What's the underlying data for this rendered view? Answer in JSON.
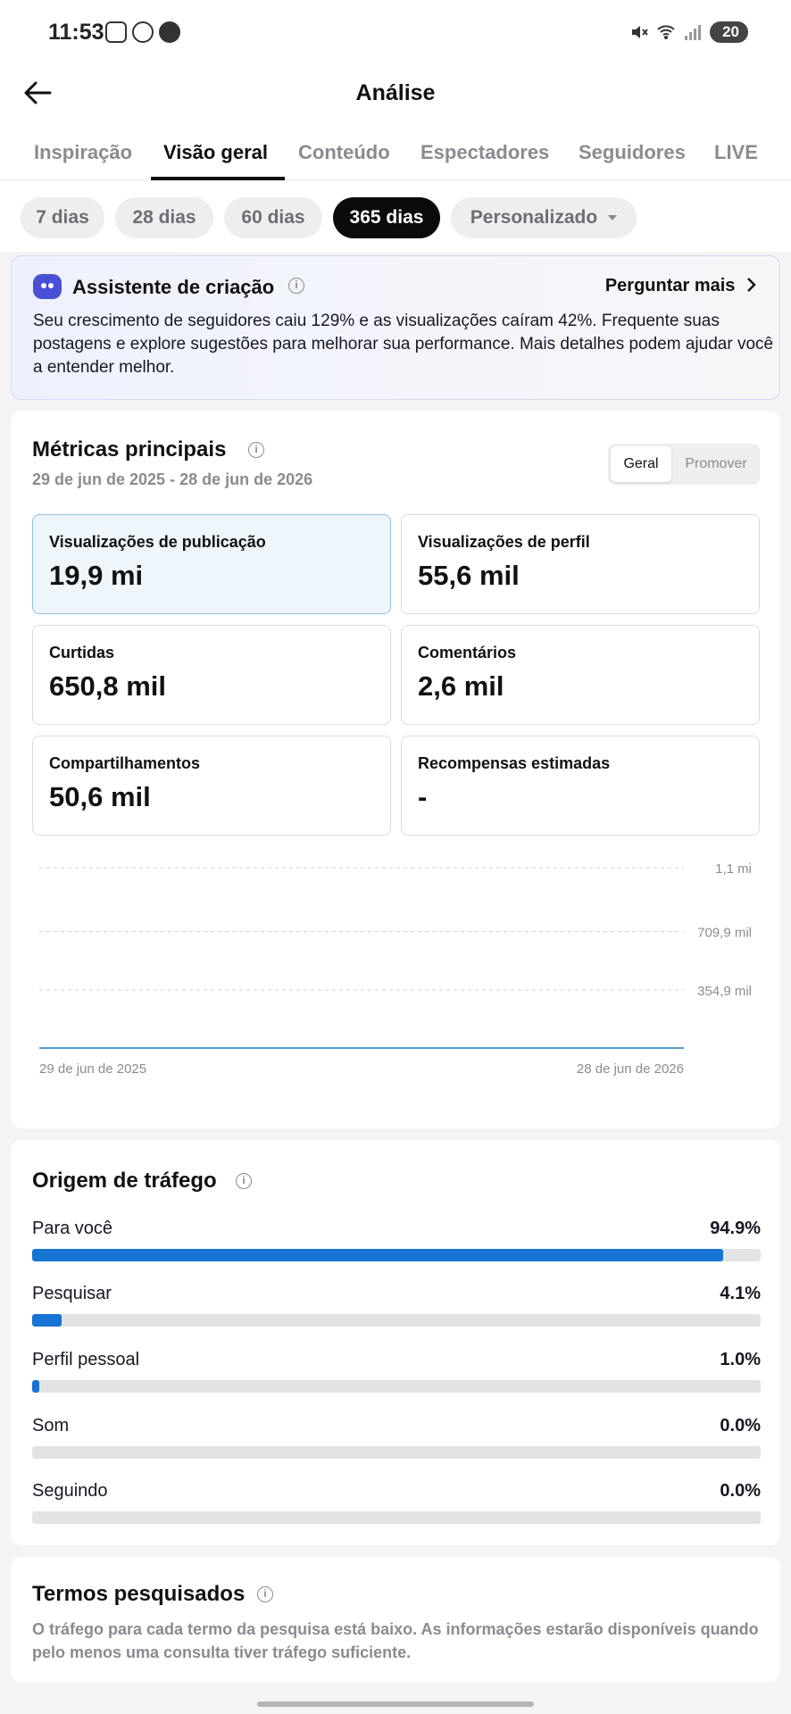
{
  "status_bar": {
    "time": "11:53",
    "battery": "20"
  },
  "header": {
    "title": "Análise"
  },
  "tabs": [
    {
      "label": "Inspiração",
      "active": false
    },
    {
      "label": "Visão geral",
      "active": true
    },
    {
      "label": "Conteúdo",
      "active": false
    },
    {
      "label": "Espectadores",
      "active": false
    },
    {
      "label": "Seguidores",
      "active": false
    },
    {
      "label": "LIVE",
      "active": false
    }
  ],
  "periods": [
    {
      "label": "7 dias",
      "active": false
    },
    {
      "label": "28 dias",
      "active": false
    },
    {
      "label": "60 dias",
      "active": false
    },
    {
      "label": "365 dias",
      "active": true
    },
    {
      "label": "Personalizado",
      "active": false
    }
  ],
  "assistant": {
    "title": "Assistente de criação",
    "more": "Perguntar mais",
    "text": "Seu crescimento de seguidores caiu 129% e as visualizações caíram 42%. Frequente suas postagens e explore sugestões para melhorar sua performance. Mais detalhes podem ajudar você a entender melhor."
  },
  "metrics": {
    "title": "Métricas principais",
    "date_range": "29 de jun de 2025 - 28 de jun de 2026",
    "toggle": {
      "on": "Geral",
      "off": "Promover"
    },
    "tiles": [
      {
        "label": "Visualizações de publicação",
        "value": "19,9 mi",
        "selected": true
      },
      {
        "label": "Visualizações de perfil",
        "value": "55,6 mil",
        "selected": false
      },
      {
        "label": "Curtidas",
        "value": "650,8 mil",
        "selected": false
      },
      {
        "label": "Comentários",
        "value": "2,6 mil",
        "selected": false
      },
      {
        "label": "Compartilhamentos",
        "value": "50,6 mil",
        "selected": false
      },
      {
        "label": "Recompensas estimadas",
        "value": "-",
        "selected": false
      }
    ]
  },
  "chart_data": {
    "type": "line",
    "title": "",
    "series": [
      {
        "values": [
          0,
          0,
          0,
          0,
          0,
          0,
          0,
          0,
          0,
          0,
          0,
          0,
          0,
          0,
          0,
          0,
          0,
          0,
          0,
          0,
          0,
          0,
          0,
          0,
          0,
          0,
          0,
          0,
          0,
          0,
          0,
          0,
          0,
          0,
          0,
          0,
          0,
          0,
          0,
          0,
          0,
          0,
          0,
          0,
          0,
          0,
          0,
          0,
          0,
          0,
          0,
          0,
          0,
          0,
          0,
          0,
          0,
          0,
          0,
          0,
          0,
          0,
          0,
          0,
          0,
          0,
          0,
          0,
          0,
          0,
          0,
          0,
          0,
          0,
          0,
          0,
          0,
          0,
          0,
          0,
          0,
          0,
          0,
          0,
          0,
          0,
          0,
          0,
          0,
          0,
          0,
          0,
          0,
          0,
          0,
          0,
          0,
          0,
          0,
          0,
          0,
          0,
          0,
          0,
          0,
          0,
          0,
          0,
          0,
          0,
          0,
          0,
          0,
          0,
          0,
          0,
          0,
          0,
          0,
          0,
          0,
          0,
          0,
          0,
          0,
          0,
          0,
          0,
          0,
          0,
          0,
          0,
          0,
          0,
          0,
          0,
          0,
          0,
          0,
          0,
          0,
          0,
          0,
          0,
          0,
          0,
          0,
          0,
          0,
          0,
          0,
          0,
          0,
          0,
          0,
          0,
          0,
          0,
          0,
          0,
          0,
          0,
          0,
          0,
          0,
          0,
          0,
          0,
          0,
          0,
          0,
          0,
          0,
          0,
          0,
          0,
          0,
          0,
          0,
          0,
          0,
          0,
          0,
          0,
          0,
          0,
          0,
          0,
          0,
          0,
          0,
          0,
          0,
          0,
          0,
          0,
          0,
          0,
          0,
          0,
          0,
          0,
          0,
          0,
          0,
          0,
          0,
          0,
          0,
          0,
          0,
          0,
          0,
          0,
          0,
          0,
          0,
          0,
          0,
          0,
          0,
          0,
          0,
          0,
          0,
          0,
          0,
          0,
          0,
          0,
          0,
          0,
          0,
          0,
          0,
          0,
          0,
          0,
          0,
          0,
          0,
          0,
          0,
          0,
          0,
          0,
          0,
          0,
          0,
          0,
          0,
          0,
          0,
          0,
          0,
          0,
          0,
          0,
          0,
          0,
          0,
          0,
          0,
          0,
          0,
          0,
          0,
          0,
          0,
          0,
          0,
          0,
          0,
          0,
          0,
          0,
          0,
          0,
          0,
          0,
          0,
          0,
          0,
          0,
          0,
          0,
          0,
          0,
          0,
          0,
          0,
          0,
          0,
          0,
          0,
          0,
          0,
          0,
          0,
          0,
          0,
          0,
          0,
          0,
          0,
          0,
          0,
          0,
          0,
          0,
          0,
          0,
          0,
          0,
          0,
          0,
          0,
          0,
          0,
          0,
          0,
          0,
          0,
          0,
          0,
          0,
          0,
          0,
          0,
          0,
          0,
          0,
          0,
          0,
          0,
          0,
          0,
          0,
          0,
          0,
          0,
          0,
          0,
          0,
          0,
          0,
          0,
          0,
          0,
          0,
          0,
          0,
          0,
          0,
          0,
          0,
          0,
          0,
          0
        ]
      }
    ],
    "x_start": "29 de jun de 2025",
    "x_end": "28 de jun de 2026",
    "y_ticks": [
      "1,1 mi",
      "709,9 mil",
      "354,9 mil"
    ],
    "ylim": [
      0,
      1100000
    ],
    "grid": true
  },
  "traffic": {
    "title": "Origem de tráfego",
    "rows": [
      {
        "label": "Para você",
        "value": "94.9%",
        "fraction": 0.949
      },
      {
        "label": "Pesquisar",
        "value": "4.1%",
        "fraction": 0.041
      },
      {
        "label": "Perfil pessoal",
        "value": "1.0%",
        "fraction": 0.01
      },
      {
        "label": "Som",
        "value": "0.0%",
        "fraction": 0
      },
      {
        "label": "Seguindo",
        "value": "0.0%",
        "fraction": 0
      }
    ]
  },
  "terms": {
    "title": "Termos pesquisados",
    "text": "O tráfego para cada termo da pesquisa está baixo. As informações estarão disponíveis quando pelo menos uma consulta tiver tráfego suficiente."
  },
  "colors": {
    "accent": "#1574d4",
    "chart_line": "#3d8fc7",
    "selected_tile_bg": "#eef6fc"
  }
}
